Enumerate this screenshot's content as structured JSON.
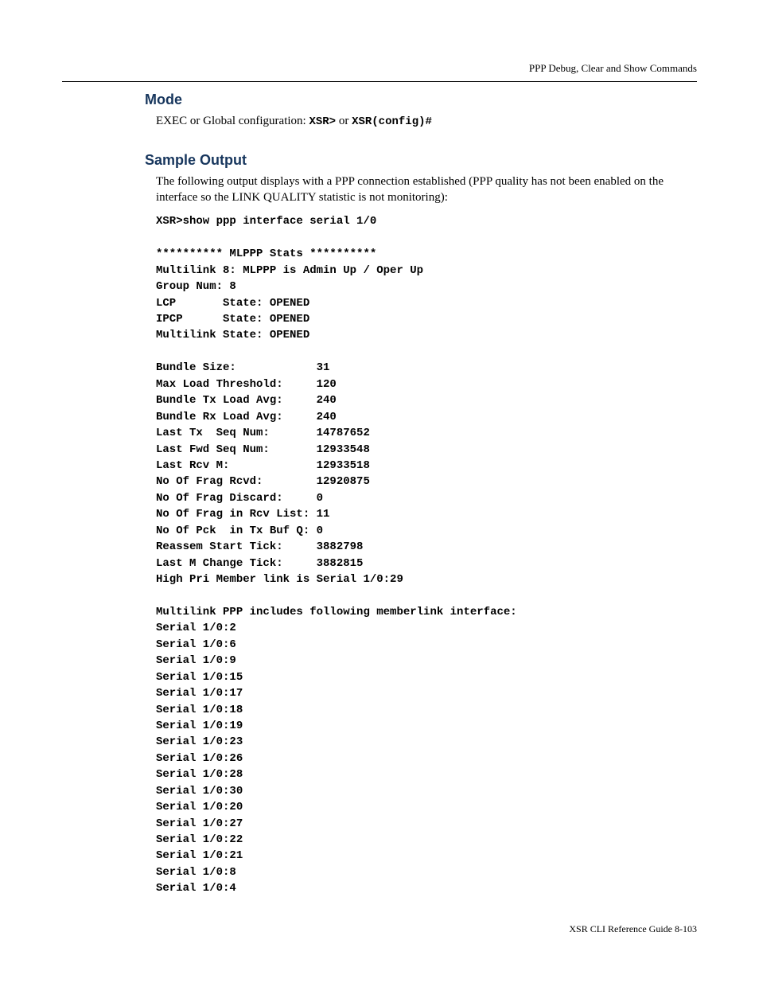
{
  "header": {
    "running_title": "PPP Debug, Clear and Show Commands"
  },
  "sections": {
    "mode": {
      "title": "Mode",
      "text_prefix": "EXEC or Global configuration: ",
      "code1": "XSR>",
      "joiner": " or ",
      "code2": "XSR(config)#"
    },
    "sample_output": {
      "title": "Sample Output",
      "intro": "The following output displays with a PPP connection established (PPP quality has not been enabled on the interface so the LINK QUALITY statistic is not monitoring):",
      "code": "XSR>show ppp interface serial 1/0\n\n********** MLPPP Stats **********\nMultilink 8: MLPPP is Admin Up / Oper Up\nGroup Num: 8\nLCP       State: OPENED\nIPCP      State: OPENED\nMultilink State: OPENED\n\nBundle Size:            31\nMax Load Threshold:     120\nBundle Tx Load Avg:     240\nBundle Rx Load Avg:     240\nLast Tx  Seq Num:       14787652\nLast Fwd Seq Num:       12933548\nLast Rcv M:             12933518\nNo Of Frag Rcvd:        12920875\nNo Of Frag Discard:     0\nNo Of Frag in Rcv List: 11\nNo Of Pck  in Tx Buf Q: 0\nReassem Start Tick:     3882798\nLast M Change Tick:     3882815\nHigh Pri Member link is Serial 1/0:29\n\nMultilink PPP includes following memberlink interface:\nSerial 1/0:2\nSerial 1/0:6\nSerial 1/0:9\nSerial 1/0:15\nSerial 1/0:17\nSerial 1/0:18\nSerial 1/0:19\nSerial 1/0:23\nSerial 1/0:26\nSerial 1/0:28\nSerial 1/0:30\nSerial 1/0:20\nSerial 1/0:27\nSerial 1/0:22\nSerial 1/0:21\nSerial 1/0:8\nSerial 1/0:4"
    }
  },
  "footer": {
    "text": "XSR CLI Reference Guide   8-103"
  }
}
